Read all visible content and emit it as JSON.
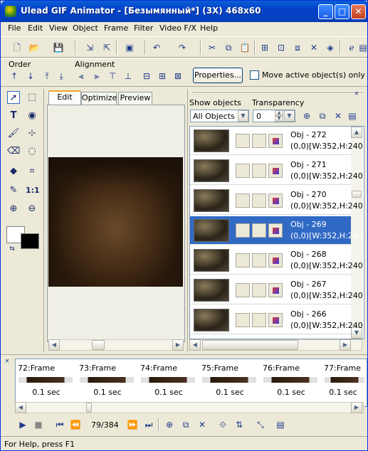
{
  "window": {
    "title": "Ulead GIF Animator - [Безымянный*] (3X) 468x60",
    "min": "_",
    "max": "□",
    "close": "✕"
  },
  "menu": [
    "File",
    "Edit",
    "View",
    "Object",
    "Frame",
    "Filter",
    "Video F/X",
    "Help"
  ],
  "toolbar2": {
    "order_label": "Order",
    "alignment_label": "Alignment",
    "properties_label": "Properties...",
    "move_active_label": "Move active object(s) only"
  },
  "canvas_tabs": [
    "Edit",
    "Optimize",
    "Preview"
  ],
  "objects_panel": {
    "show_objects_label": "Show objects",
    "transparency_label": "Transparency",
    "show_value": "All Objects",
    "transparency_value": "0",
    "items": [
      {
        "name": "Obj - 272",
        "info": "(0,0)[W:352,H:240"
      },
      {
        "name": "Obj - 271",
        "info": "(0,0)[W:352,H:240"
      },
      {
        "name": "Obj - 270",
        "info": "(0,0)[W:352,H:240"
      },
      {
        "name": "Obj - 269",
        "info": "(0,0)[W:352,H:240"
      },
      {
        "name": "Obj - 268",
        "info": "(0,0)[W:352,H:240"
      },
      {
        "name": "Obj - 267",
        "info": "(0,0)[W:352,H:240"
      },
      {
        "name": "Obj - 266",
        "info": "(0,0)[W:352,H:240"
      }
    ]
  },
  "frames": [
    {
      "name": "72:Frame",
      "delay": "0.1 sec"
    },
    {
      "name": "73:Frame",
      "delay": "0.1 sec"
    },
    {
      "name": "74:Frame",
      "delay": "0.1 sec"
    },
    {
      "name": "75:Frame",
      "delay": "0.1 sec"
    },
    {
      "name": "76:Frame",
      "delay": "0.1 sec"
    },
    {
      "name": "77:Frame",
      "delay": "0.1 sec"
    }
  ],
  "playback": {
    "counter": "79/384"
  },
  "status": "For Help, press F1",
  "icons": [
    "app-icon",
    "new-icon",
    "open-icon",
    "save-icon",
    "import-icon",
    "export-icon",
    "undo-icon",
    "redo-icon",
    "cut-icon",
    "copy-icon",
    "paste-icon",
    "pointer-icon",
    "text-icon",
    "brush-icon",
    "zoom-in-icon",
    "zoom-out-icon",
    "play-icon",
    "stop-icon",
    "first-frame-icon",
    "prev-frame-icon",
    "next-frame-icon",
    "last-frame-icon"
  ]
}
